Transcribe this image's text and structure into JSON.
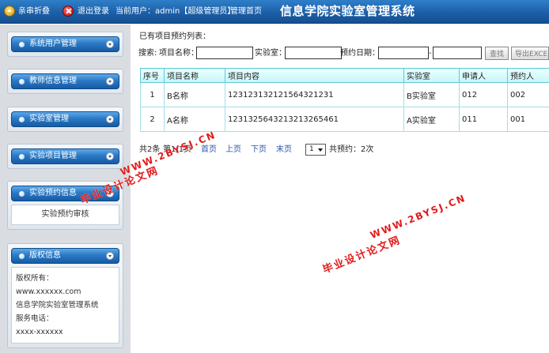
{
  "topbar": {
    "home_label": "亲串折叠",
    "logout_label": "退出登录",
    "current_user_label": "当前用户：admin【超级管理员】",
    "admin_home_label": "管理首页",
    "system_title": "信息学院实验室管理系统",
    "home_icon": "home-icon",
    "logout_icon": "exit-icon"
  },
  "sidebar": {
    "menus": [
      {
        "label": "系统用户管理"
      },
      {
        "label": "教师信息管理"
      },
      {
        "label": "实验室管理"
      },
      {
        "label": "实验项目管理"
      },
      {
        "label": "实验预约信息",
        "sub_items": [
          "实验预约审核"
        ]
      }
    ],
    "copyright": {
      "title": "版权信息",
      "lines": [
        "版权所有：",
        "www.xxxxxx.com",
        "信息学院实验室管理系统",
        "服务电话：",
        "xxxx-xxxxxx"
      ]
    }
  },
  "main": {
    "list_title": "已有项目预约列表：",
    "search": {
      "label": "搜索:",
      "project_name_label": "项目名称：",
      "project_name_value": "",
      "lab_label": "实验室：",
      "lab_value": "",
      "date_label": "预约日期：",
      "date_from": "",
      "date_sep": "-",
      "date_to": "",
      "find_button": "查找",
      "export_button": "导出EXCEL"
    },
    "table": {
      "headers": [
        "序号",
        "项目名称",
        "项目内容",
        "实验室",
        "申请人",
        "预约人"
      ],
      "rows": [
        [
          "1",
          "B名称",
          "12312313212156432123​1",
          "B实验室",
          "012",
          "002"
        ],
        [
          "2",
          "A名称",
          "1231325643213213265461",
          "A实验室",
          "011",
          "001"
        ]
      ]
    },
    "pager": {
      "records": "共2条",
      "pages": "第1/1页",
      "first": "首页",
      "prev": "上页",
      "next": "下页",
      "last": "末页",
      "current_page": "1",
      "total": "共预约：2次"
    }
  },
  "watermarks": {
    "site_1": "WWW.2BYSJ.CN",
    "name_1": "毕业设计论文网",
    "site_2": "WWW.2BYSJ.CN",
    "name_2": "毕业设计论文网"
  },
  "colors": {
    "topbar": "#1c5fa8",
    "menu_head": "#2a79c6",
    "table_header": "#c9f5f7",
    "table_border": "#62c8d6",
    "watermark": "#e21b1b"
  }
}
